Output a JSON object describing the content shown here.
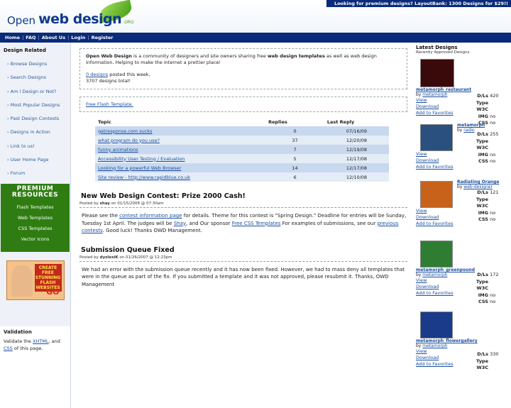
{
  "header": {
    "promo": "Looking for premium designs?  LayoutBank: 1300 Designs for $29!!",
    "logo_open": "Open",
    "logo_wd": "web design",
    "logo_org": ".ORG"
  },
  "nav": [
    "Home",
    "FAQ",
    "About Us",
    "Login",
    "Register"
  ],
  "sidebar": {
    "title": "Design Related",
    "items": [
      "Browse Designs",
      "Search Designs",
      "Am I Design or Not?",
      "Most Popular Designs",
      "Past Design Contests",
      "Designs in Action",
      "Link to us!",
      "User Home Page",
      "Forum"
    ],
    "premium_title_1": "PREMIUM",
    "premium_title_2": "RESOURCES",
    "premium_items": [
      "Flash Templates",
      "Web Templates",
      "CSS Templates",
      "Vector Icons"
    ],
    "ad_text": "CREATE FREE STUNNING FLASH WEBSITES",
    "ad_go": "GO",
    "validation_title": "Validation",
    "validation_pre": "Validate the ",
    "validation_xhtml": "XHTML",
    "validation_mid": ", and",
    "validation_css": "CSS",
    "validation_post": " of this page."
  },
  "intro": {
    "owd": "Open Web Design",
    "text1": " is a community of designers and site owners sharing free ",
    "bold": "web design templates",
    "text2": " as well as web design information. Helping to make the internet a prettier place!",
    "count_link": "0 designs",
    "count_text": " posted this week,",
    "total": "3707 designs total!"
  },
  "flash_link": "Free Flash Template.",
  "forum": {
    "headers": [
      "Topic",
      "Replies",
      "Last Reply"
    ],
    "rows": [
      {
        "topic": "getresponse.com sucks",
        "replies": "0",
        "last": "07/16/09"
      },
      {
        "topic": "what program do you use?",
        "replies": "37",
        "last": "12/20/08"
      },
      {
        "topic": "funny animations",
        "replies": "7",
        "last": "12/19/08"
      },
      {
        "topic": "Accessibility User Testing / Evaluation",
        "replies": "5",
        "last": "12/17/08"
      },
      {
        "topic": "Looking for a powerful Web Browser",
        "replies": "14",
        "last": "12/17/08"
      },
      {
        "topic": "Site review - http://www.rapidblue.co.uk",
        "replies": "6",
        "last": "12/10/08"
      }
    ]
  },
  "posts": [
    {
      "title": "New Web Design Contest: Prize 2000 Cash!",
      "meta_pre": "Posted by ",
      "author": "shay",
      "meta_post": " on 01/15/2008 @ 07:30am",
      "b1": "Please see the ",
      "l1": "contest information page",
      "b2": " for details. Theme for this contest is \"Spring Design.\" Deadline for entries will be Sunday, Tuesday 1st April. The judges will be ",
      "l2": "Shay",
      "b3": ", and Our sponsor ",
      "l3": "Free CSS Templates",
      "b4": " For examples of submissions, see our ",
      "l4": "previous contests",
      "b5": ". Good luck! Thanks OWD Management."
    },
    {
      "title": "Submission Queue Fixed",
      "meta_pre": "Posted by ",
      "author": "dyzlexiK",
      "meta_post": " on 01/26/2007 @ 12:23pm",
      "body": "We had an error with the submission queue recently and it has now been fixed. However, we had to mass deny all templates that were in the queue as part of the fix. If you submitted a template and it was not approved, please resubmit it. Thanks, OWD Management"
    }
  ],
  "latest": {
    "title": "Latest Designs",
    "subtitle": "Recently Approved Designs",
    "by": "by ",
    "view": "View",
    "download": "Download",
    "fav": "Add to Favorites",
    "stat_labels": [
      "D/Ls",
      "Type",
      "W3C",
      "IMG",
      "CSS"
    ],
    "designs": [
      {
        "name": "metamorph_restaurant",
        "author": "metamorph",
        "dl": "420",
        "img": "no",
        "css": "no",
        "color": "#3a0a0a"
      },
      {
        "name": "metamorph",
        "author": "radio",
        "dl": "255",
        "img": "no",
        "css": "no",
        "color": "#2a5080"
      },
      {
        "name": "Radiating Orange",
        "author": "web-designer",
        "dl": "121",
        "img": "no",
        "css": "no",
        "color": "#c8621a"
      },
      {
        "name": "metamorph_greenpound",
        "author": "metamorph",
        "dl": "172",
        "img": "no",
        "css": "no",
        "color": "#2e7d32"
      },
      {
        "name": "metamorph_flowergallery",
        "author": "metamorph",
        "dl": "330",
        "img": "",
        "css": "",
        "color": "#1a3a8a"
      }
    ]
  }
}
